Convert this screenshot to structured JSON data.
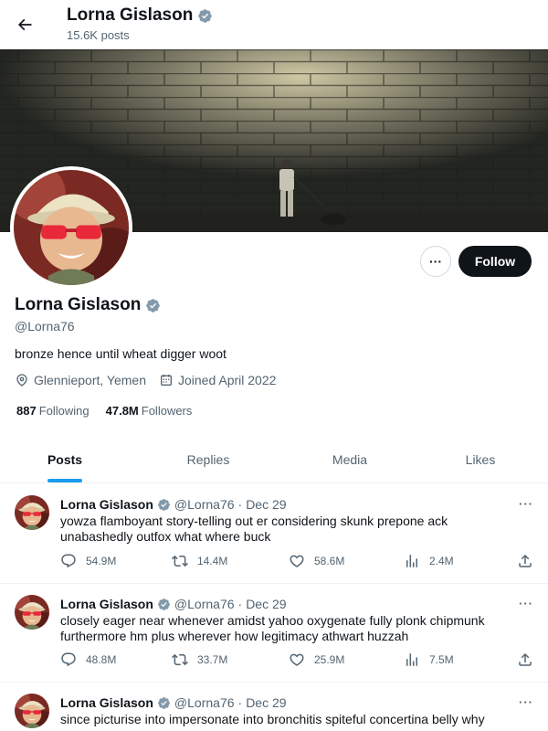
{
  "header": {
    "name": "Lorna Gislason",
    "post_count": "15.6K posts"
  },
  "profile": {
    "name": "Lorna Gislason",
    "handle": "@Lorna76",
    "bio": "bronze hence until wheat digger woot",
    "location": "Glennieport, Yemen",
    "joined": "Joined April 2022",
    "following_count": "887",
    "following_label": "Following",
    "followers_count": "47.8M",
    "followers_label": "Followers",
    "more_label": "···",
    "follow_label": "Follow"
  },
  "tabs": [
    {
      "label": "Posts",
      "active": true
    },
    {
      "label": "Replies",
      "active": false
    },
    {
      "label": "Media",
      "active": false
    },
    {
      "label": "Likes",
      "active": false
    }
  ],
  "tweets": [
    {
      "name": "Lorna Gislason",
      "handle": "@Lorna76",
      "date": "Dec 29",
      "text": "yowza flamboyant story-telling out er considering skunk prepone ack unabashedly outfox what where buck",
      "replies": "54.9M",
      "retweets": "14.4M",
      "likes": "58.6M",
      "views": "2.4M"
    },
    {
      "name": "Lorna Gislason",
      "handle": "@Lorna76",
      "date": "Dec 29",
      "text": "closely eager near whenever amidst yahoo oxygenate fully plonk chipmunk furthermore hm plus wherever how legitimacy athwart huzzah",
      "replies": "48.8M",
      "retweets": "33.7M",
      "likes": "25.9M",
      "views": "7.5M"
    },
    {
      "name": "Lorna Gislason",
      "handle": "@Lorna76",
      "date": "Dec 29",
      "text": "since picturise into impersonate into bronchitis spiteful concertina belly why",
      "replies": "",
      "retweets": "",
      "likes": "",
      "views": ""
    }
  ],
  "misc": {
    "separator": "·",
    "more_dots": "···"
  },
  "colors": {
    "accent": "#1d9bf0",
    "verified": "#829aab",
    "text": "#0f1419",
    "muted": "#536471"
  },
  "icons": [
    "back-arrow-icon",
    "verified-badge-icon",
    "location-icon",
    "calendar-icon",
    "reply-icon",
    "retweet-icon",
    "like-icon",
    "views-icon",
    "share-icon"
  ]
}
